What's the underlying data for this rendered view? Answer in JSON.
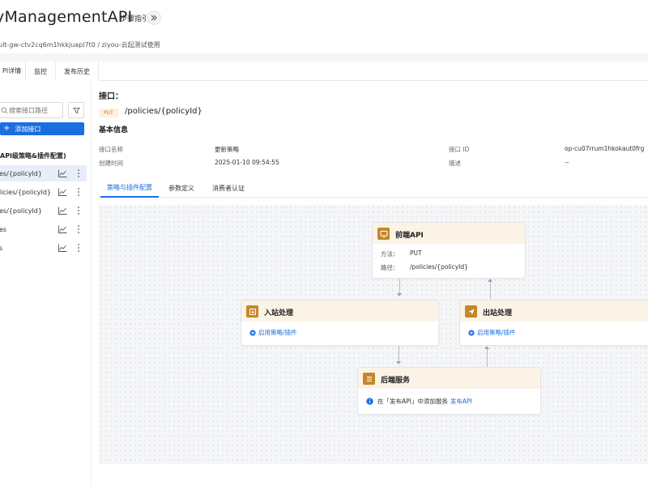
{
  "header": {
    "title": "ManagementAPI",
    "title_prefix_fragment": "y",
    "guide_label": "步骤指引"
  },
  "breadcrumb": {
    "text": "ult-gw-ctv2cq6m1hkkjuapl7t0 / ziyou-云起测试使用"
  },
  "top_tabs": [
    {
      "label": "PI详情",
      "active": true
    },
    {
      "label": "监控",
      "active": false
    },
    {
      "label": "发布历史",
      "active": false
    }
  ],
  "sidebar": {
    "search_placeholder": "搜索接口路径",
    "add_label": "添加接口",
    "group_title": "API级策略&插件配置)",
    "items": [
      {
        "label": "es/{policyId}",
        "active": true
      },
      {
        "label": "licies/{policyId}",
        "active": false
      },
      {
        "label": "es/{policyId}",
        "active": false
      },
      {
        "label": "es",
        "active": false
      },
      {
        "label": "s",
        "active": false
      }
    ]
  },
  "main": {
    "interface_label": "接口：",
    "method": "PUT",
    "path": "/policies/{policyId}",
    "basic_info_title": "基本信息",
    "info": {
      "name_label": "接口名称",
      "name_value": "更新策略",
      "id_label": "接口 ID",
      "id_value": "op-cu07rrum1hkokaut0frg",
      "created_label": "创建时间",
      "created_value": "2025-01-10 09:54:55",
      "desc_label": "描述",
      "desc_value": "--"
    },
    "sub_tabs": [
      {
        "label": "策略与插件配置",
        "active": true
      },
      {
        "label": "参数定义",
        "active": false
      },
      {
        "label": "消费者认证",
        "active": false
      }
    ]
  },
  "flow": {
    "frontend": {
      "title": "前端API",
      "method_label": "方法：",
      "method_value": "PUT",
      "path_label": "路径：",
      "path_value": "/policies/{policyId}"
    },
    "inbound": {
      "title": "入站处理",
      "link_label": "启用策略/插件"
    },
    "outbound": {
      "title": "出站处理",
      "link_label": "启用策略/插件"
    },
    "backend": {
      "title": "后端服务",
      "info_text": "在「发布API」中添加服务",
      "info_link": "发布API"
    }
  },
  "colors": {
    "primary": "#1a6fe0",
    "node_header": "#fbf3e6",
    "node_icon": "#c4872b",
    "method_tag_bg": "#fdf0e0",
    "method_tag_text": "#c77a1a"
  }
}
